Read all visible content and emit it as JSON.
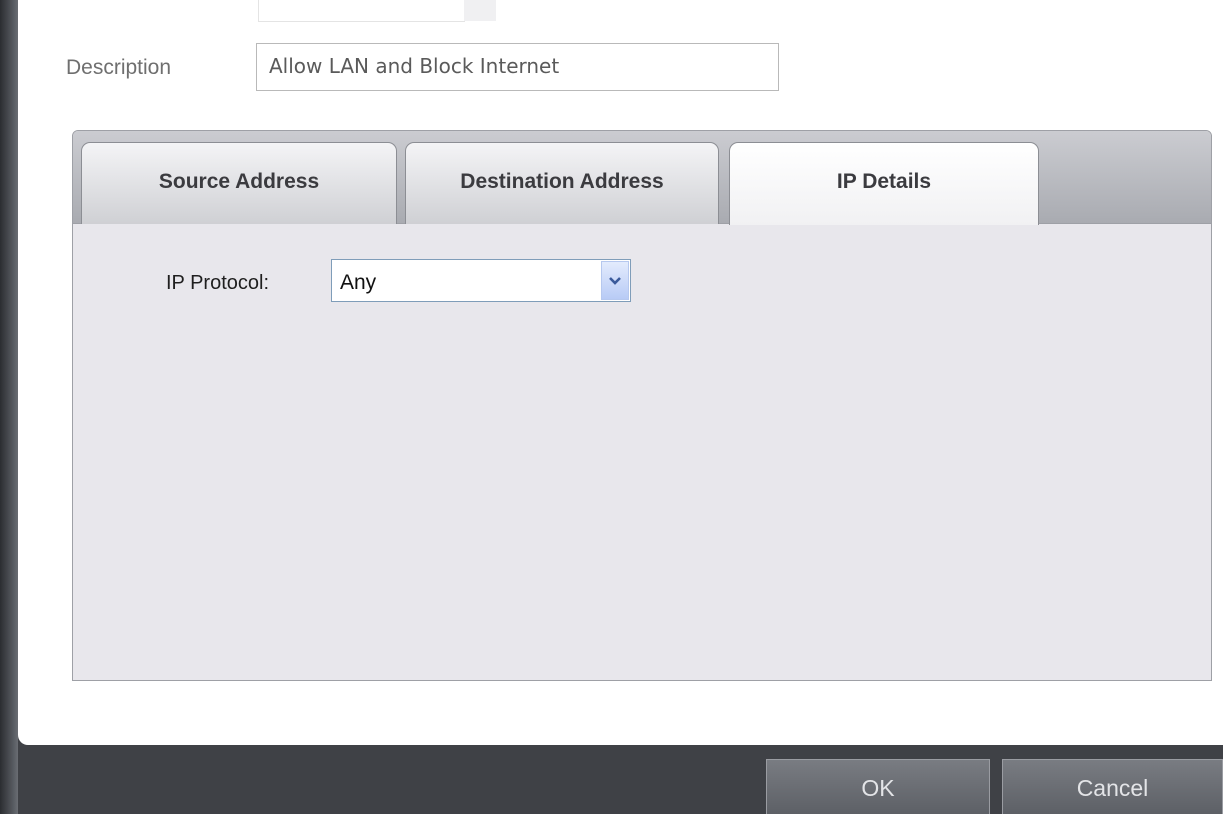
{
  "form": {
    "description_label": "Description",
    "description_value": "Allow LAN and Block Internet"
  },
  "tabs": [
    {
      "label": "Source Address",
      "active": false
    },
    {
      "label": "Destination Address",
      "active": false
    },
    {
      "label": "IP Details",
      "active": true
    }
  ],
  "ip_details": {
    "protocol_label": "IP Protocol:",
    "protocol_value": "Any"
  },
  "buttons": {
    "ok": "OK",
    "cancel": "Cancel"
  },
  "colors": {
    "tab_strip": "#b6b8bd",
    "panel": "#e8e7ec",
    "bottom_bar": "#3f4146",
    "dropdown_arrow": "#3a5a9b"
  }
}
